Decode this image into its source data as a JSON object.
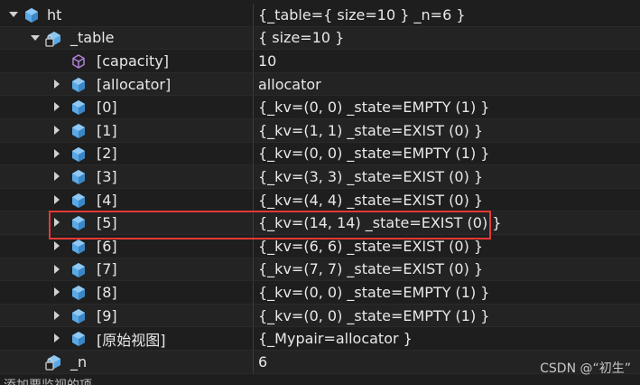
{
  "rows": [
    {
      "name": "ht",
      "value": "{_table={ size=10 } _n=6 }"
    },
    {
      "name": "_table",
      "value": "{ size=10 }"
    },
    {
      "name": "[capacity]",
      "value": "10"
    },
    {
      "name": "[allocator]",
      "value": "allocator"
    },
    {
      "name": "[0]",
      "value": "{_kv=(0, 0) _state=EMPTY (1) }"
    },
    {
      "name": "[1]",
      "value": "{_kv=(1, 1) _state=EXIST (0) }"
    },
    {
      "name": "[2]",
      "value": "{_kv=(0, 0) _state=EMPTY (1) }"
    },
    {
      "name": "[3]",
      "value": "{_kv=(3, 3) _state=EXIST (0) }"
    },
    {
      "name": "[4]",
      "value": "{_kv=(4, 4) _state=EXIST (0) }"
    },
    {
      "name": "[5]",
      "value": "{_kv=(14, 14) _state=EXIST (0) }"
    },
    {
      "name": "[6]",
      "value": "{_kv=(6, 6) _state=EXIST (0) }"
    },
    {
      "name": "[7]",
      "value": "{_kv=(7, 7) _state=EXIST (0) }"
    },
    {
      "name": "[8]",
      "value": "{_kv=(0, 0) _state=EMPTY (1) }"
    },
    {
      "name": "[9]",
      "value": "{_kv=(0, 0) _state=EMPTY (1) }"
    },
    {
      "name": "[原始视图]",
      "value": "{_Mypair=allocator }"
    },
    {
      "name": "_n",
      "value": "6"
    }
  ],
  "watermark": "CSDN @“初生”",
  "footer_partial": "添加要监视的项",
  "colors": {
    "background": "#1e1e1e",
    "text": "#e8e8e8",
    "field_icon": "#5aa9e6",
    "property_icon": "#b180d7",
    "highlight_border": "#e53935"
  }
}
